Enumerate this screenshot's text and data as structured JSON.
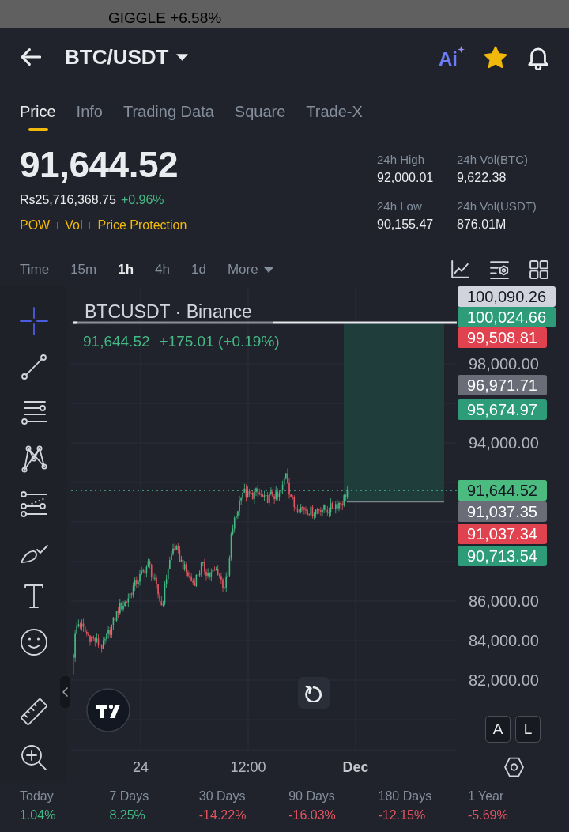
{
  "ticker_notice": "GIGGLE +6.58%",
  "header": {
    "pair": "BTC/USDT",
    "ai_label": "Ai",
    "favorited": true
  },
  "tabs": [
    {
      "label": "Price",
      "selected": true
    },
    {
      "label": "Info",
      "selected": false
    },
    {
      "label": "Trading Data",
      "selected": false
    },
    {
      "label": "Square",
      "selected": false
    },
    {
      "label": "Trade-X",
      "selected": false
    }
  ],
  "price": {
    "last": "91,644.52",
    "local_value": "Rs25,716,368.75",
    "change": "+0.96%",
    "rising": true,
    "tags": [
      "POW",
      "Vol",
      "Price Protection"
    ]
  },
  "stats": [
    {
      "label": "24h High",
      "value": "92,000.01"
    },
    {
      "label": "24h Vol(BTC)",
      "value": "9,622.38"
    },
    {
      "label": "24h Low",
      "value": "90,155.47"
    },
    {
      "label": "24h Vol(USDT)",
      "value": "876.01M"
    }
  ],
  "intervals": [
    {
      "label": "Time",
      "kind": "option",
      "selected": false
    },
    {
      "label": "15m",
      "kind": "option",
      "selected": false
    },
    {
      "label": "1h",
      "kind": "option",
      "selected": true
    },
    {
      "label": "4h",
      "kind": "option",
      "selected": false
    },
    {
      "label": "1d",
      "kind": "option",
      "selected": false
    },
    {
      "label": "More",
      "kind": "menu",
      "selected": false
    }
  ],
  "drawing_tools": [
    {
      "selected": true
    },
    {
      "selected": false
    },
    {
      "selected": false
    },
    {
      "selected": false
    },
    {
      "selected": false
    },
    {
      "selected": false
    },
    {
      "selected": false
    },
    {
      "selected": false
    },
    {
      "selected": false
    },
    {
      "selected": false
    }
  ],
  "chart": {
    "symbol": "BTCUSDT · Binance",
    "legend_price": "91,644.52",
    "legend_change": "+175.01 (+0.19%)",
    "rising": true,
    "price_tags": [
      {
        "text": "100,090.26",
        "color": "#d1d4dc"
      },
      {
        "text": "100,024.66",
        "color": "#2e9b79"
      },
      {
        "text": "99,508.81",
        "color": "#e0434f"
      },
      {
        "text": "96,971.71",
        "color": "#6a6d78"
      },
      {
        "text": "95,674.97",
        "color": "#2e9b79"
      },
      {
        "text": "91,644.52",
        "color": "#4cbb7f"
      },
      {
        "text": "91,037.35",
        "color": "#6a6d78"
      },
      {
        "text": "91,037.34",
        "color": "#e0434f"
      },
      {
        "text": "90,713.54",
        "color": "#2e9b79"
      }
    ],
    "price_ticks": [
      "98,000.00",
      "94,000.00",
      "86,000.00",
      "84,000.00",
      "82,000.00"
    ],
    "time_labels": [
      {
        "label": "24",
        "major": false
      },
      {
        "label": "12:00",
        "major": false
      },
      {
        "label": "Dec",
        "major": true
      }
    ],
    "scale_buttons": [
      "A",
      "L"
    ]
  },
  "performance": [
    {
      "period": "Today",
      "change": "1.04%",
      "rising": true
    },
    {
      "period": "7 Days",
      "change": "8.25%",
      "rising": true
    },
    {
      "period": "30 Days",
      "change": "-14.22%",
      "rising": false
    },
    {
      "period": "90 Days",
      "change": "-16.03%",
      "rising": false
    },
    {
      "period": "180 Days",
      "change": "-12.15%",
      "rising": false
    },
    {
      "period": "1 Year",
      "change": "-5.69%",
      "rising": false
    }
  ]
}
